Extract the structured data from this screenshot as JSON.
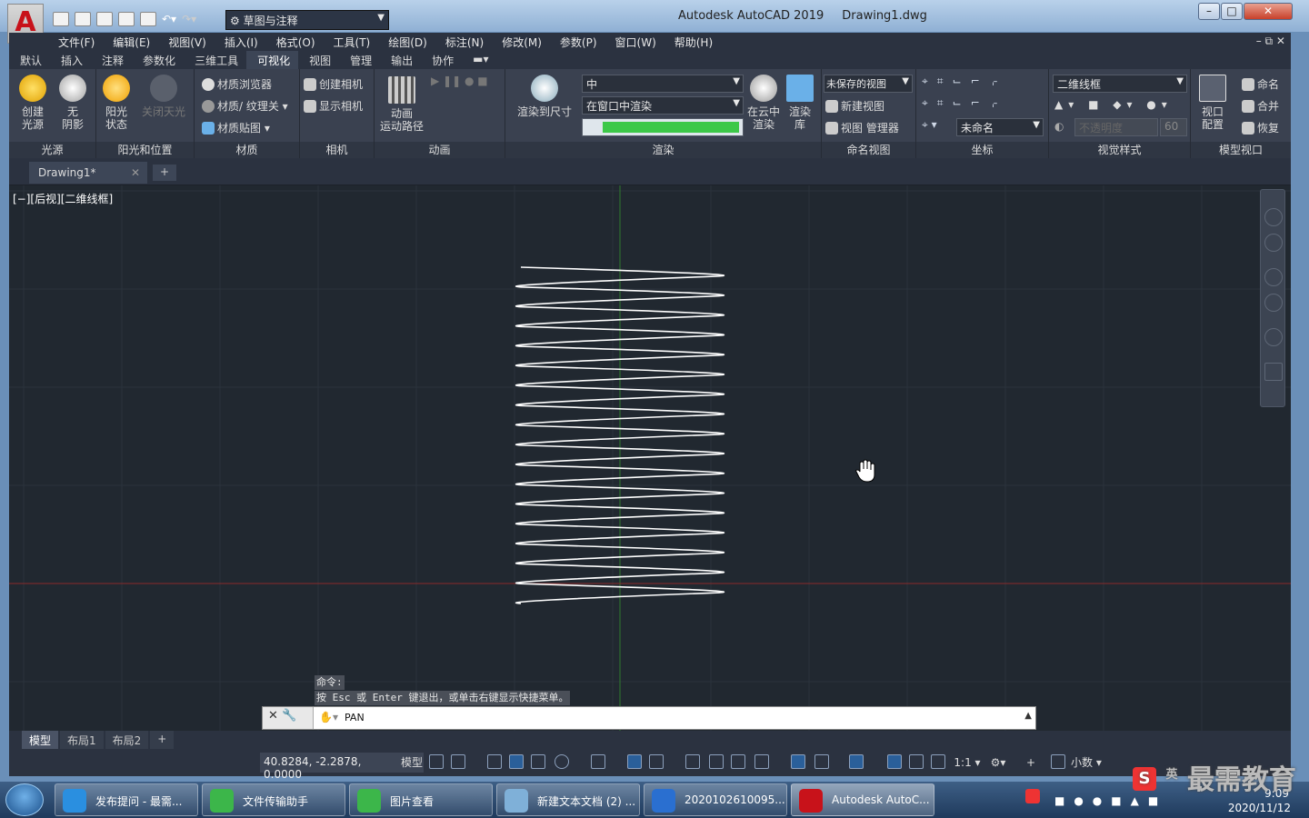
{
  "titlebar": {
    "app_name": "Autodesk AutoCAD 2019",
    "file_name": "Drawing1.dwg",
    "workspace": "草图与注释",
    "logo": "A"
  },
  "menubar": [
    "文件(F)",
    "编辑(E)",
    "视图(V)",
    "插入(I)",
    "格式(O)",
    "工具(T)",
    "绘图(D)",
    "标注(N)",
    "修改(M)",
    "参数(P)",
    "窗口(W)",
    "帮助(H)"
  ],
  "ribbon_tabs": [
    "默认",
    "插入",
    "注释",
    "参数化",
    "三维工具",
    "可视化",
    "视图",
    "管理",
    "输出",
    "协作"
  ],
  "active_tab": "可视化",
  "ribbon": {
    "lights": {
      "create": "创建\n光源",
      "noshadow": "无\n阴影",
      "title": "光源"
    },
    "sun": {
      "state": "阳光\n状态",
      "off": "关闭天光",
      "title": "阳光和位置"
    },
    "materials": {
      "browser": "材质浏览器",
      "switch": "材质/ 纹理关",
      "map": "材质贴图",
      "title": "材质"
    },
    "camera": {
      "create": "创建相机",
      "show": "显示相机",
      "title": "相机"
    },
    "animation": {
      "path": "动画\n运动路径",
      "title": "动画"
    },
    "render": {
      "to_size": "渲染到尺寸",
      "quality": "中",
      "target": "在窗口中渲染",
      "cloud": "在云中\n渲染",
      "gallery": "渲染\n库",
      "title": "渲染"
    },
    "named_views": {
      "unsaved": "未保存的视图",
      "new": "新建视图",
      "manager": "视图 管理器",
      "title": "命名视图"
    },
    "coordinates": {
      "unnamed": "未命名",
      "title": "坐标"
    },
    "visual_styles": {
      "style": "二维线框",
      "opacity": "不透明度",
      "opacity_value": "60",
      "title": "视觉样式"
    },
    "model_viewports": {
      "config": "视口\n配置",
      "name": "命名",
      "join": "合并",
      "restore": "恢复",
      "title": "模型视口"
    }
  },
  "doc_tab": {
    "name": "Drawing1*",
    "add": "+"
  },
  "viewport_label": "[−][后视][二维线框]",
  "command": {
    "history1": "命令:",
    "history2": "按 Esc 或 Enter 键退出，或单击右键显示快捷菜单。",
    "current": "PAN"
  },
  "layout_tabs": [
    "模型",
    "布局1",
    "布局2",
    "+"
  ],
  "statusbar": {
    "coords": "40.8284, -2.2878, 0.0000",
    "model": "模型",
    "scale": "1:1",
    "units": "小数"
  },
  "taskbar": [
    {
      "label": "发布提问 - 最需...",
      "color": "#2a8fe0"
    },
    {
      "label": "文件传输助手",
      "color": "#3cb64a"
    },
    {
      "label": "图片查看",
      "color": "#3cb64a"
    },
    {
      "label": "新建文本文档 (2) ...",
      "color": "#7fb0d8"
    },
    {
      "label": "2020102610095...",
      "color": "#2a6fd0"
    },
    {
      "label": "Autodesk AutoC...",
      "color": "#c8121a"
    }
  ],
  "tray": {
    "time": "9:09",
    "date": "2020/11/12",
    "ime": "英"
  },
  "watermark": "最需教育",
  "colors": {
    "canvas": "#212830",
    "ribbon": "#3a4150",
    "spring": "#ffffff",
    "axis_y": "#2e7a2e",
    "axis_x": "#8a2a2a"
  }
}
